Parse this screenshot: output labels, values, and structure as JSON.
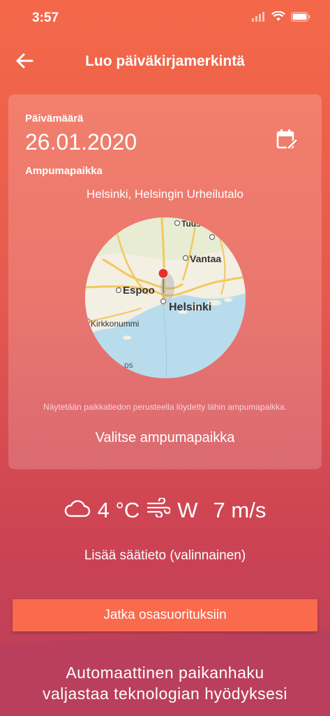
{
  "status": {
    "time": "3:57"
  },
  "nav": {
    "title": "Luo päiväkirjamerkintä"
  },
  "card": {
    "date_label": "Päivämäärä",
    "date_value": "26.01.2020",
    "place_label": "Ampumapaikka",
    "place_value": "Helsinki, Helsingin Urheilutalo",
    "map_labels": {
      "vantaa": "Vantaa",
      "espoo": "Espoo",
      "helsinki": "Helsinki",
      "kirkkonummi": "Kirkkonummi",
      "tuus": "Tuus",
      "ps": "ps"
    },
    "hint": "Näytetään paikkatiedon perusteella löydetty lähin ampumapaikka.",
    "choose_label": "Valitse ampumapaikka"
  },
  "weather": {
    "temperature": "4 °C",
    "wind_direction": "W",
    "wind_speed": "7 m/s",
    "add_label": "Lisää säätieto (valinnainen)"
  },
  "actions": {
    "continue_label": "Jatka osasuorituksiin"
  },
  "footer": {
    "line1": "Automaattinen paikanhaku",
    "line2": "valjastaa teknologian hyödyksesi"
  }
}
